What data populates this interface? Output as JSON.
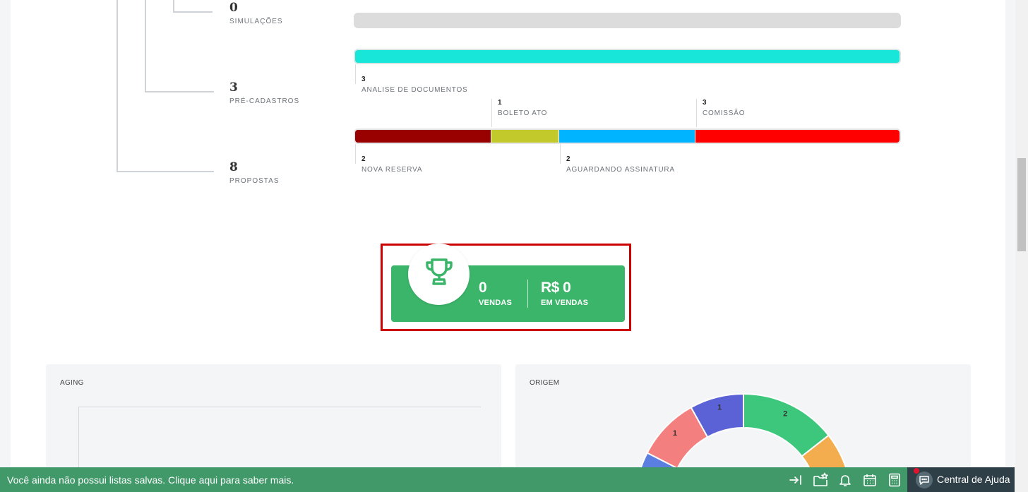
{
  "funnel": {
    "stages": [
      {
        "count": "0",
        "label": "SIMULAÇÕES"
      },
      {
        "count": "3",
        "label": "PRÉ-CADASTROS"
      },
      {
        "count": "8",
        "label": "PROPOSTAS"
      }
    ],
    "precadastro_breakdown": [
      {
        "count": "3",
        "label": "ANALISE DE DOCUMENTOS",
        "color": "#17e6d8"
      }
    ],
    "proposta_breakdown": [
      {
        "count": "2",
        "label": "NOVA RESERVA",
        "color": "#990000"
      },
      {
        "count": "1",
        "label": "BOLETO ATO",
        "color": "#c2c92b"
      },
      {
        "count": "2",
        "label": "AGUARDANDO ASSINATURA",
        "color": "#00b4ff"
      },
      {
        "count": "3",
        "label": "COMISSÃO",
        "color": "#ff0000"
      }
    ]
  },
  "sales": {
    "count": "0",
    "count_label": "VENDAS",
    "amount": "R$ 0",
    "amount_label": "EM VENDAS",
    "icon": "trophy-icon",
    "color": "#3bb56a"
  },
  "panels": {
    "aging": {
      "title": "AGING"
    },
    "origem": {
      "title": "ORIGEM"
    }
  },
  "origem_chart": {
    "chart_data": {
      "type": "pie",
      "visible_labels": [
        "2",
        "1",
        "1"
      ],
      "colors": [
        "#3cc77d",
        "#5b62d6",
        "#f47f7f",
        "#f4ad4e",
        "#5b7fe0"
      ]
    }
  },
  "bottom_bar": {
    "message": "Você ainda não possui listas salvas. Clique aqui para saber mais.",
    "icons": [
      "collapse-icon",
      "folder-star-icon",
      "bell-icon",
      "calendar-icon",
      "calculator-icon"
    ],
    "help_label": "Central de Ajuda"
  }
}
